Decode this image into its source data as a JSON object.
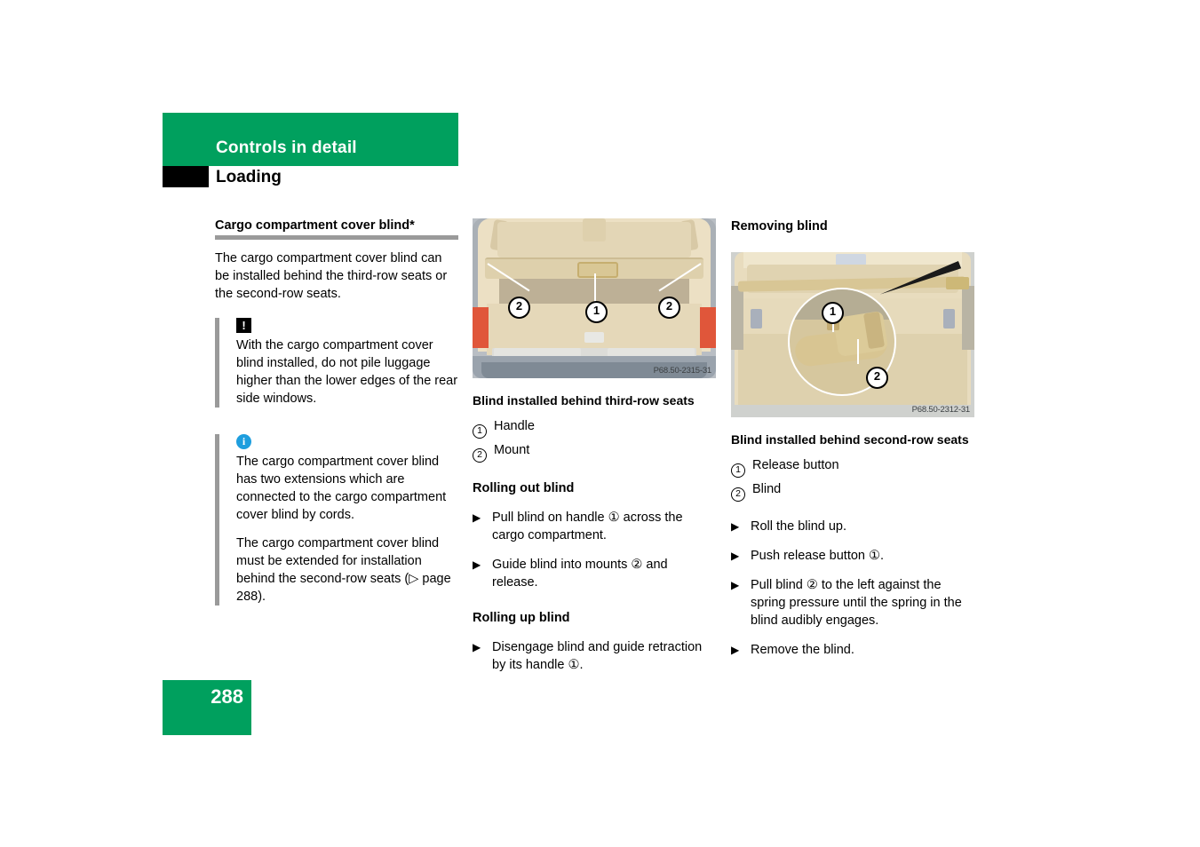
{
  "header": {
    "chapter_title": "Controls in detail",
    "section_title": "Loading"
  },
  "footer": {
    "page_number": "288"
  },
  "colors": {
    "brand_green": "#00a05e",
    "rule_gray": "#9a9a9a",
    "info_blue": "#1e9ede",
    "warning_black": "#000000"
  },
  "left_column": {
    "topic_heading": "Cargo compartment cover blind*",
    "intro_paragraph": "The cargo compartment cover blind can be installed behind the third-row seats or the second-row seats.",
    "warning_note": {
      "icon": "exclamation-icon",
      "icon_glyph": "!",
      "text": "With the cargo compartment cover blind installed, do not pile luggage higher than the lower edges of the rear side windows."
    },
    "info_note": {
      "icon": "info-icon",
      "icon_glyph": "i",
      "paragraphs": [
        "The cargo compartment cover blind has two extensions which are connected to the cargo compartment cover blind by cords.",
        "The cargo compartment cover blind must be extended for installation behind the second-row seats (▷ page 288)."
      ]
    }
  },
  "middle_column": {
    "figure": {
      "reference": "P68.50-2315-31",
      "markers": [
        {
          "number": "2",
          "position": "left"
        },
        {
          "number": "1",
          "position": "center"
        },
        {
          "number": "2",
          "position": "right"
        }
      ]
    },
    "figure_caption": "Blind installed behind third-row seats",
    "legend": [
      {
        "number": "1",
        "label": "Handle"
      },
      {
        "number": "2",
        "label": "Mount"
      }
    ],
    "sections": [
      {
        "heading": "Rolling out blind",
        "steps": [
          "Pull blind on handle ① across the cargo compartment.",
          "Guide blind into mounts ② and release."
        ]
      },
      {
        "heading": "Rolling up blind",
        "steps": [
          "Disengage blind and guide retraction by its handle ①."
        ]
      }
    ]
  },
  "right_column": {
    "heading": "Removing blind",
    "figure": {
      "reference": "P68.50-2312-31",
      "markers": [
        {
          "number": "1",
          "position": "inset-top"
        },
        {
          "number": "2",
          "position": "inset-bottom"
        }
      ]
    },
    "figure_caption": "Blind installed behind second-row seats",
    "legend": [
      {
        "number": "1",
        "label": "Release button"
      },
      {
        "number": "2",
        "label": "Blind"
      }
    ],
    "steps": [
      "Roll the blind up.",
      "Push release button ①.",
      "Pull blind ② to the left against the spring pressure until the spring in the blind audibly engages.",
      "Remove the blind."
    ]
  },
  "icons": {
    "bullet_arrow": "▶"
  }
}
